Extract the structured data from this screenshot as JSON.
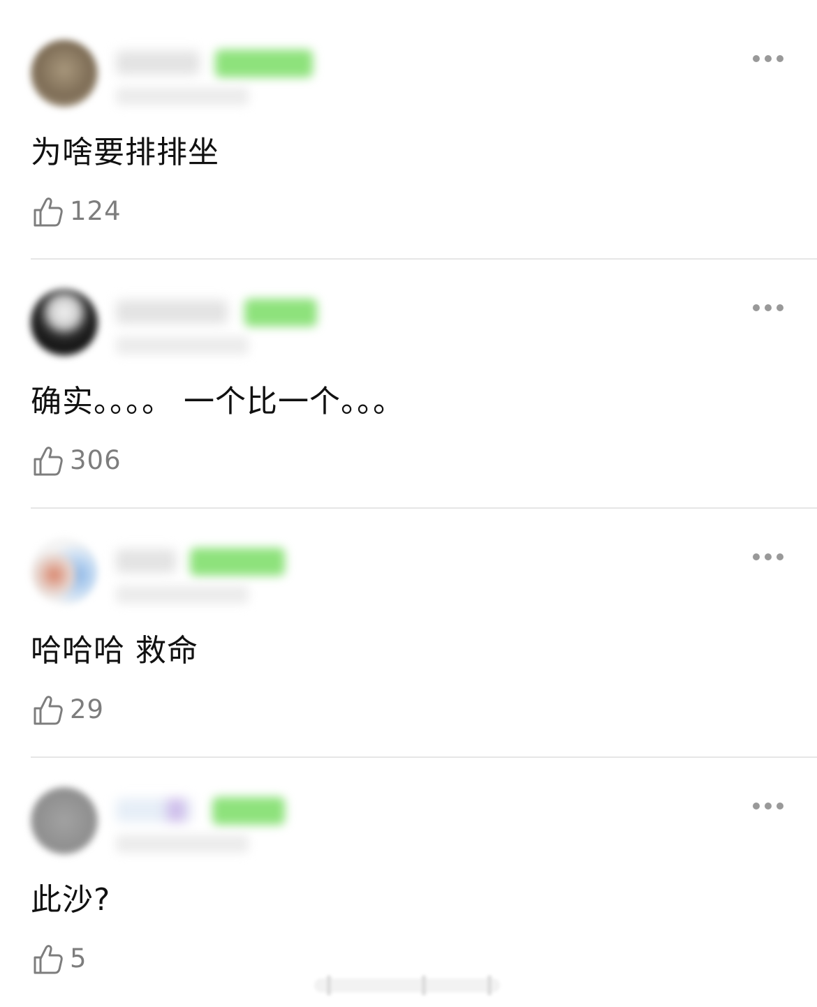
{
  "comments": [
    {
      "text": "为啥要排排坐",
      "likes": "124",
      "like_icon": "thumbs-up-icon",
      "more_icon": "more-dots-icon",
      "avatar_color": "#8a7a63"
    },
    {
      "text": "确实。。。。 一个比一个。。。",
      "likes": "306",
      "like_icon": "thumbs-up-icon",
      "more_icon": "more-dots-icon",
      "avatar_color": "#3a3a3a"
    },
    {
      "text": "哈哈哈 救命",
      "likes": "29",
      "like_icon": "thumbs-up-icon",
      "more_icon": "more-dots-icon",
      "avatar_color": "#b5c9df"
    },
    {
      "text": "此沙?",
      "likes": "5",
      "like_icon": "thumbs-up-icon",
      "more_icon": "more-dots-icon",
      "avatar_color": "#9b9b9b"
    }
  ],
  "colors": {
    "badge_green": "#8ee27c",
    "divider": "#e6e6e6",
    "like_text": "#7d7d7d",
    "more_dots": "#999999"
  }
}
